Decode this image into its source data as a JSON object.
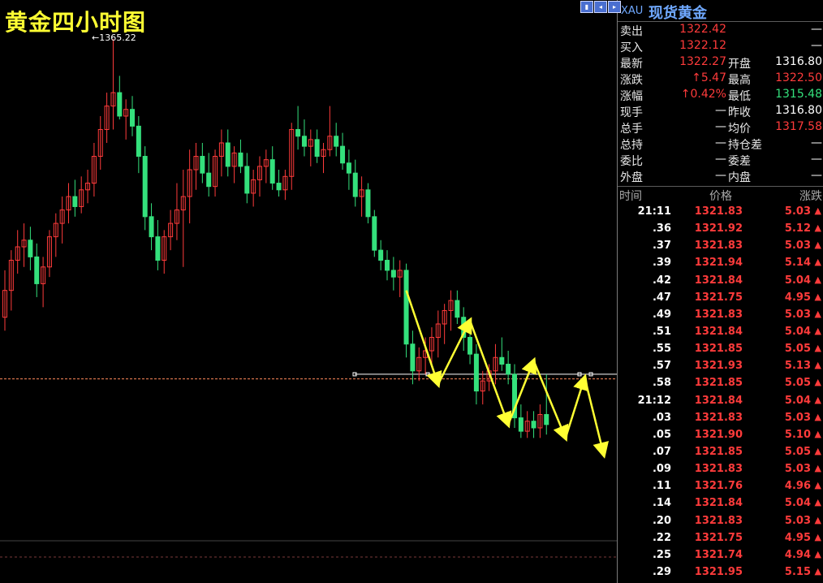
{
  "title": "黄金四小时图",
  "max_label": "1365.22",
  "symbol": "XAU",
  "symbol_name": "现货黄金",
  "quote": {
    "rows": [
      {
        "l1": "卖出",
        "v1": "1322.42",
        "c1": "red",
        "l2": "",
        "v2": "—",
        "c2": "white"
      },
      {
        "l1": "买入",
        "v1": "1322.12",
        "c1": "red",
        "l2": "",
        "v2": "—",
        "c2": "white"
      },
      {
        "l1": "最新",
        "v1": "1322.27",
        "c1": "red",
        "l2": "开盘",
        "v2": "1316.80",
        "c2": "white"
      },
      {
        "l1": "涨跌",
        "v1": "↑5.47",
        "c1": "red",
        "l2": "最高",
        "v2": "1322.50",
        "c2": "red"
      },
      {
        "l1": "涨幅",
        "v1": "↑0.42%",
        "c1": "red",
        "l2": "最低",
        "v2": "1315.48",
        "c2": "green"
      },
      {
        "l1": "现手",
        "v1": "—",
        "c1": "white",
        "l2": "昨收",
        "v2": "1316.80",
        "c2": "white"
      },
      {
        "l1": "总手",
        "v1": "—",
        "c1": "white",
        "l2": "均价",
        "v2": "1317.58",
        "c2": "red"
      },
      {
        "l1": "总持",
        "v1": "—",
        "c1": "white",
        "l2": "持仓差",
        "v2": "—",
        "c2": "white"
      },
      {
        "l1": "委比",
        "v1": "—",
        "c1": "white",
        "l2": "委差",
        "v2": "—",
        "c2": "white"
      },
      {
        "l1": "外盘",
        "v1": "—",
        "c1": "white",
        "l2": "内盘",
        "v2": "—",
        "c2": "white"
      }
    ]
  },
  "ticks": {
    "headers": {
      "time": "时间",
      "price": "价格",
      "change": "涨跌"
    },
    "rows": [
      {
        "time": "21:11",
        "price": "1321.83",
        "change": "5.03"
      },
      {
        "time": ".36",
        "price": "1321.92",
        "change": "5.12"
      },
      {
        "time": ".37",
        "price": "1321.83",
        "change": "5.03"
      },
      {
        "time": ".39",
        "price": "1321.94",
        "change": "5.14"
      },
      {
        "time": ".42",
        "price": "1321.84",
        "change": "5.04"
      },
      {
        "time": ".47",
        "price": "1321.75",
        "change": "4.95"
      },
      {
        "time": ".49",
        "price": "1321.83",
        "change": "5.03"
      },
      {
        "time": ".51",
        "price": "1321.84",
        "change": "5.04"
      },
      {
        "time": ".55",
        "price": "1321.85",
        "change": "5.05"
      },
      {
        "time": ".57",
        "price": "1321.93",
        "change": "5.13"
      },
      {
        "time": ".58",
        "price": "1321.85",
        "change": "5.05"
      },
      {
        "time": "21:12",
        "price": "1321.84",
        "change": "5.04"
      },
      {
        "time": ".03",
        "price": "1321.83",
        "change": "5.03"
      },
      {
        "time": ".05",
        "price": "1321.90",
        "change": "5.10"
      },
      {
        "time": ".07",
        "price": "1321.85",
        "change": "5.05"
      },
      {
        "time": ".09",
        "price": "1321.83",
        "change": "5.03"
      },
      {
        "time": ".11",
        "price": "1321.76",
        "change": "4.96"
      },
      {
        "time": ".14",
        "price": "1321.84",
        "change": "5.04"
      },
      {
        "time": ".20",
        "price": "1321.83",
        "change": "5.03"
      },
      {
        "time": ".22",
        "price": "1321.75",
        "change": "4.95"
      },
      {
        "time": ".25",
        "price": "1321.74",
        "change": "4.94"
      },
      {
        "time": ".29",
        "price": "1321.95",
        "change": "5.15"
      }
    ]
  },
  "colors": {
    "up": "#ff3b3b",
    "down": "#34e07c",
    "bg": "#000000",
    "annotation": "#ffff33",
    "title": "#ffff33"
  },
  "chart_data": {
    "type": "candlestick",
    "title": "黄金四小时图",
    "max_label": "1365.22",
    "candles": [
      {
        "o": 1282,
        "h": 1296,
        "l": 1278,
        "c": 1290
      },
      {
        "o": 1290,
        "h": 1302,
        "l": 1284,
        "c": 1299
      },
      {
        "o": 1299,
        "h": 1308,
        "l": 1295,
        "c": 1303
      },
      {
        "o": 1303,
        "h": 1310,
        "l": 1297,
        "c": 1305
      },
      {
        "o": 1305,
        "h": 1309,
        "l": 1296,
        "c": 1300
      },
      {
        "o": 1300,
        "h": 1304,
        "l": 1288,
        "c": 1292
      },
      {
        "o": 1292,
        "h": 1300,
        "l": 1285,
        "c": 1297
      },
      {
        "o": 1297,
        "h": 1308,
        "l": 1294,
        "c": 1306
      },
      {
        "o": 1306,
        "h": 1313,
        "l": 1300,
        "c": 1310
      },
      {
        "o": 1310,
        "h": 1318,
        "l": 1304,
        "c": 1314
      },
      {
        "o": 1314,
        "h": 1322,
        "l": 1310,
        "c": 1318
      },
      {
        "o": 1318,
        "h": 1323,
        "l": 1312,
        "c": 1315
      },
      {
        "o": 1315,
        "h": 1324,
        "l": 1313,
        "c": 1320
      },
      {
        "o": 1320,
        "h": 1326,
        "l": 1316,
        "c": 1322
      },
      {
        "o": 1322,
        "h": 1334,
        "l": 1318,
        "c": 1330
      },
      {
        "o": 1330,
        "h": 1342,
        "l": 1326,
        "c": 1338
      },
      {
        "o": 1338,
        "h": 1349,
        "l": 1334,
        "c": 1345
      },
      {
        "o": 1345,
        "h": 1365,
        "l": 1338,
        "c": 1349
      },
      {
        "o": 1349,
        "h": 1354,
        "l": 1341,
        "c": 1342
      },
      {
        "o": 1342,
        "h": 1347,
        "l": 1335,
        "c": 1344
      },
      {
        "o": 1344,
        "h": 1348,
        "l": 1336,
        "c": 1339
      },
      {
        "o": 1339,
        "h": 1342,
        "l": 1325,
        "c": 1330
      },
      {
        "o": 1330,
        "h": 1333,
        "l": 1308,
        "c": 1312
      },
      {
        "o": 1312,
        "h": 1316,
        "l": 1302,
        "c": 1306
      },
      {
        "o": 1306,
        "h": 1311,
        "l": 1296,
        "c": 1299
      },
      {
        "o": 1299,
        "h": 1308,
        "l": 1295,
        "c": 1306
      },
      {
        "o": 1306,
        "h": 1314,
        "l": 1302,
        "c": 1310
      },
      {
        "o": 1310,
        "h": 1322,
        "l": 1305,
        "c": 1314
      },
      {
        "o": 1314,
        "h": 1326,
        "l": 1297,
        "c": 1318
      },
      {
        "o": 1318,
        "h": 1332,
        "l": 1310,
        "c": 1326
      },
      {
        "o": 1326,
        "h": 1334,
        "l": 1320,
        "c": 1330
      },
      {
        "o": 1330,
        "h": 1334,
        "l": 1322,
        "c": 1325
      },
      {
        "o": 1325,
        "h": 1331,
        "l": 1318,
        "c": 1321
      },
      {
        "o": 1321,
        "h": 1332,
        "l": 1318,
        "c": 1330
      },
      {
        "o": 1330,
        "h": 1338,
        "l": 1324,
        "c": 1334
      },
      {
        "o": 1334,
        "h": 1338,
        "l": 1324,
        "c": 1327
      },
      {
        "o": 1327,
        "h": 1333,
        "l": 1322,
        "c": 1331
      },
      {
        "o": 1331,
        "h": 1335,
        "l": 1325,
        "c": 1327
      },
      {
        "o": 1327,
        "h": 1331,
        "l": 1316,
        "c": 1319
      },
      {
        "o": 1319,
        "h": 1326,
        "l": 1315,
        "c": 1323
      },
      {
        "o": 1323,
        "h": 1330,
        "l": 1318,
        "c": 1327
      },
      {
        "o": 1327,
        "h": 1332,
        "l": 1322,
        "c": 1329
      },
      {
        "o": 1329,
        "h": 1333,
        "l": 1320,
        "c": 1322
      },
      {
        "o": 1322,
        "h": 1326,
        "l": 1318,
        "c": 1320
      },
      {
        "o": 1320,
        "h": 1326,
        "l": 1317,
        "c": 1324
      },
      {
        "o": 1324,
        "h": 1340,
        "l": 1320,
        "c": 1338
      },
      {
        "o": 1338,
        "h": 1345,
        "l": 1332,
        "c": 1336
      },
      {
        "o": 1336,
        "h": 1341,
        "l": 1330,
        "c": 1333
      },
      {
        "o": 1333,
        "h": 1338,
        "l": 1327,
        "c": 1335
      },
      {
        "o": 1335,
        "h": 1338,
        "l": 1328,
        "c": 1330
      },
      {
        "o": 1330,
        "h": 1334,
        "l": 1325,
        "c": 1332
      },
      {
        "o": 1332,
        "h": 1345,
        "l": 1330,
        "c": 1336
      },
      {
        "o": 1336,
        "h": 1340,
        "l": 1330,
        "c": 1333
      },
      {
        "o": 1333,
        "h": 1337,
        "l": 1326,
        "c": 1328
      },
      {
        "o": 1328,
        "h": 1332,
        "l": 1320,
        "c": 1325
      },
      {
        "o": 1325,
        "h": 1329,
        "l": 1315,
        "c": 1318
      },
      {
        "o": 1318,
        "h": 1324,
        "l": 1312,
        "c": 1320
      },
      {
        "o": 1320,
        "h": 1322,
        "l": 1310,
        "c": 1312
      },
      {
        "o": 1312,
        "h": 1314,
        "l": 1300,
        "c": 1302
      },
      {
        "o": 1302,
        "h": 1305,
        "l": 1296,
        "c": 1299
      },
      {
        "o": 1299,
        "h": 1302,
        "l": 1293,
        "c": 1296
      },
      {
        "o": 1296,
        "h": 1300,
        "l": 1290,
        "c": 1294
      },
      {
        "o": 1294,
        "h": 1299,
        "l": 1288,
        "c": 1296
      },
      {
        "o": 1296,
        "h": 1298,
        "l": 1270,
        "c": 1274
      },
      {
        "o": 1274,
        "h": 1278,
        "l": 1262,
        "c": 1266
      },
      {
        "o": 1266,
        "h": 1273,
        "l": 1263,
        "c": 1270
      },
      {
        "o": 1270,
        "h": 1276,
        "l": 1265,
        "c": 1272
      },
      {
        "o": 1272,
        "h": 1279,
        "l": 1268,
        "c": 1276
      },
      {
        "o": 1276,
        "h": 1284,
        "l": 1270,
        "c": 1280
      },
      {
        "o": 1280,
        "h": 1286,
        "l": 1274,
        "c": 1284
      },
      {
        "o": 1284,
        "h": 1290,
        "l": 1278,
        "c": 1287
      },
      {
        "o": 1287,
        "h": 1290,
        "l": 1280,
        "c": 1282
      },
      {
        "o": 1282,
        "h": 1285,
        "l": 1272,
        "c": 1276
      },
      {
        "o": 1276,
        "h": 1279,
        "l": 1268,
        "c": 1271
      },
      {
        "o": 1271,
        "h": 1274,
        "l": 1256,
        "c": 1260
      },
      {
        "o": 1260,
        "h": 1266,
        "l": 1256,
        "c": 1263
      },
      {
        "o": 1263,
        "h": 1268,
        "l": 1260,
        "c": 1266
      },
      {
        "o": 1266,
        "h": 1274,
        "l": 1262,
        "c": 1270
      },
      {
        "o": 1270,
        "h": 1276,
        "l": 1266,
        "c": 1268
      },
      {
        "o": 1268,
        "h": 1272,
        "l": 1262,
        "c": 1265
      },
      {
        "o": 1265,
        "h": 1268,
        "l": 1249,
        "c": 1252
      },
      {
        "o": 1252,
        "h": 1256,
        "l": 1246,
        "c": 1248
      },
      {
        "o": 1248,
        "h": 1254,
        "l": 1246,
        "c": 1251
      },
      {
        "o": 1251,
        "h": 1254,
        "l": 1246,
        "c": 1249
      },
      {
        "o": 1249,
        "h": 1256,
        "l": 1246,
        "c": 1253
      },
      {
        "o": 1253,
        "h": 1265,
        "l": 1247,
        "c": 1250
      }
    ],
    "levels": [
      1265.0,
      1263.6
    ],
    "annotation_path": [
      {
        "i": 63,
        "p": 1290
      },
      {
        "i": 68,
        "p": 1262
      },
      {
        "i": 73,
        "p": 1281
      },
      {
        "i": 79,
        "p": 1250
      },
      {
        "i": 83,
        "p": 1269
      },
      {
        "i": 88,
        "p": 1246
      },
      {
        "i": 91,
        "p": 1264
      },
      {
        "i": 94,
        "p": 1241
      }
    ]
  }
}
